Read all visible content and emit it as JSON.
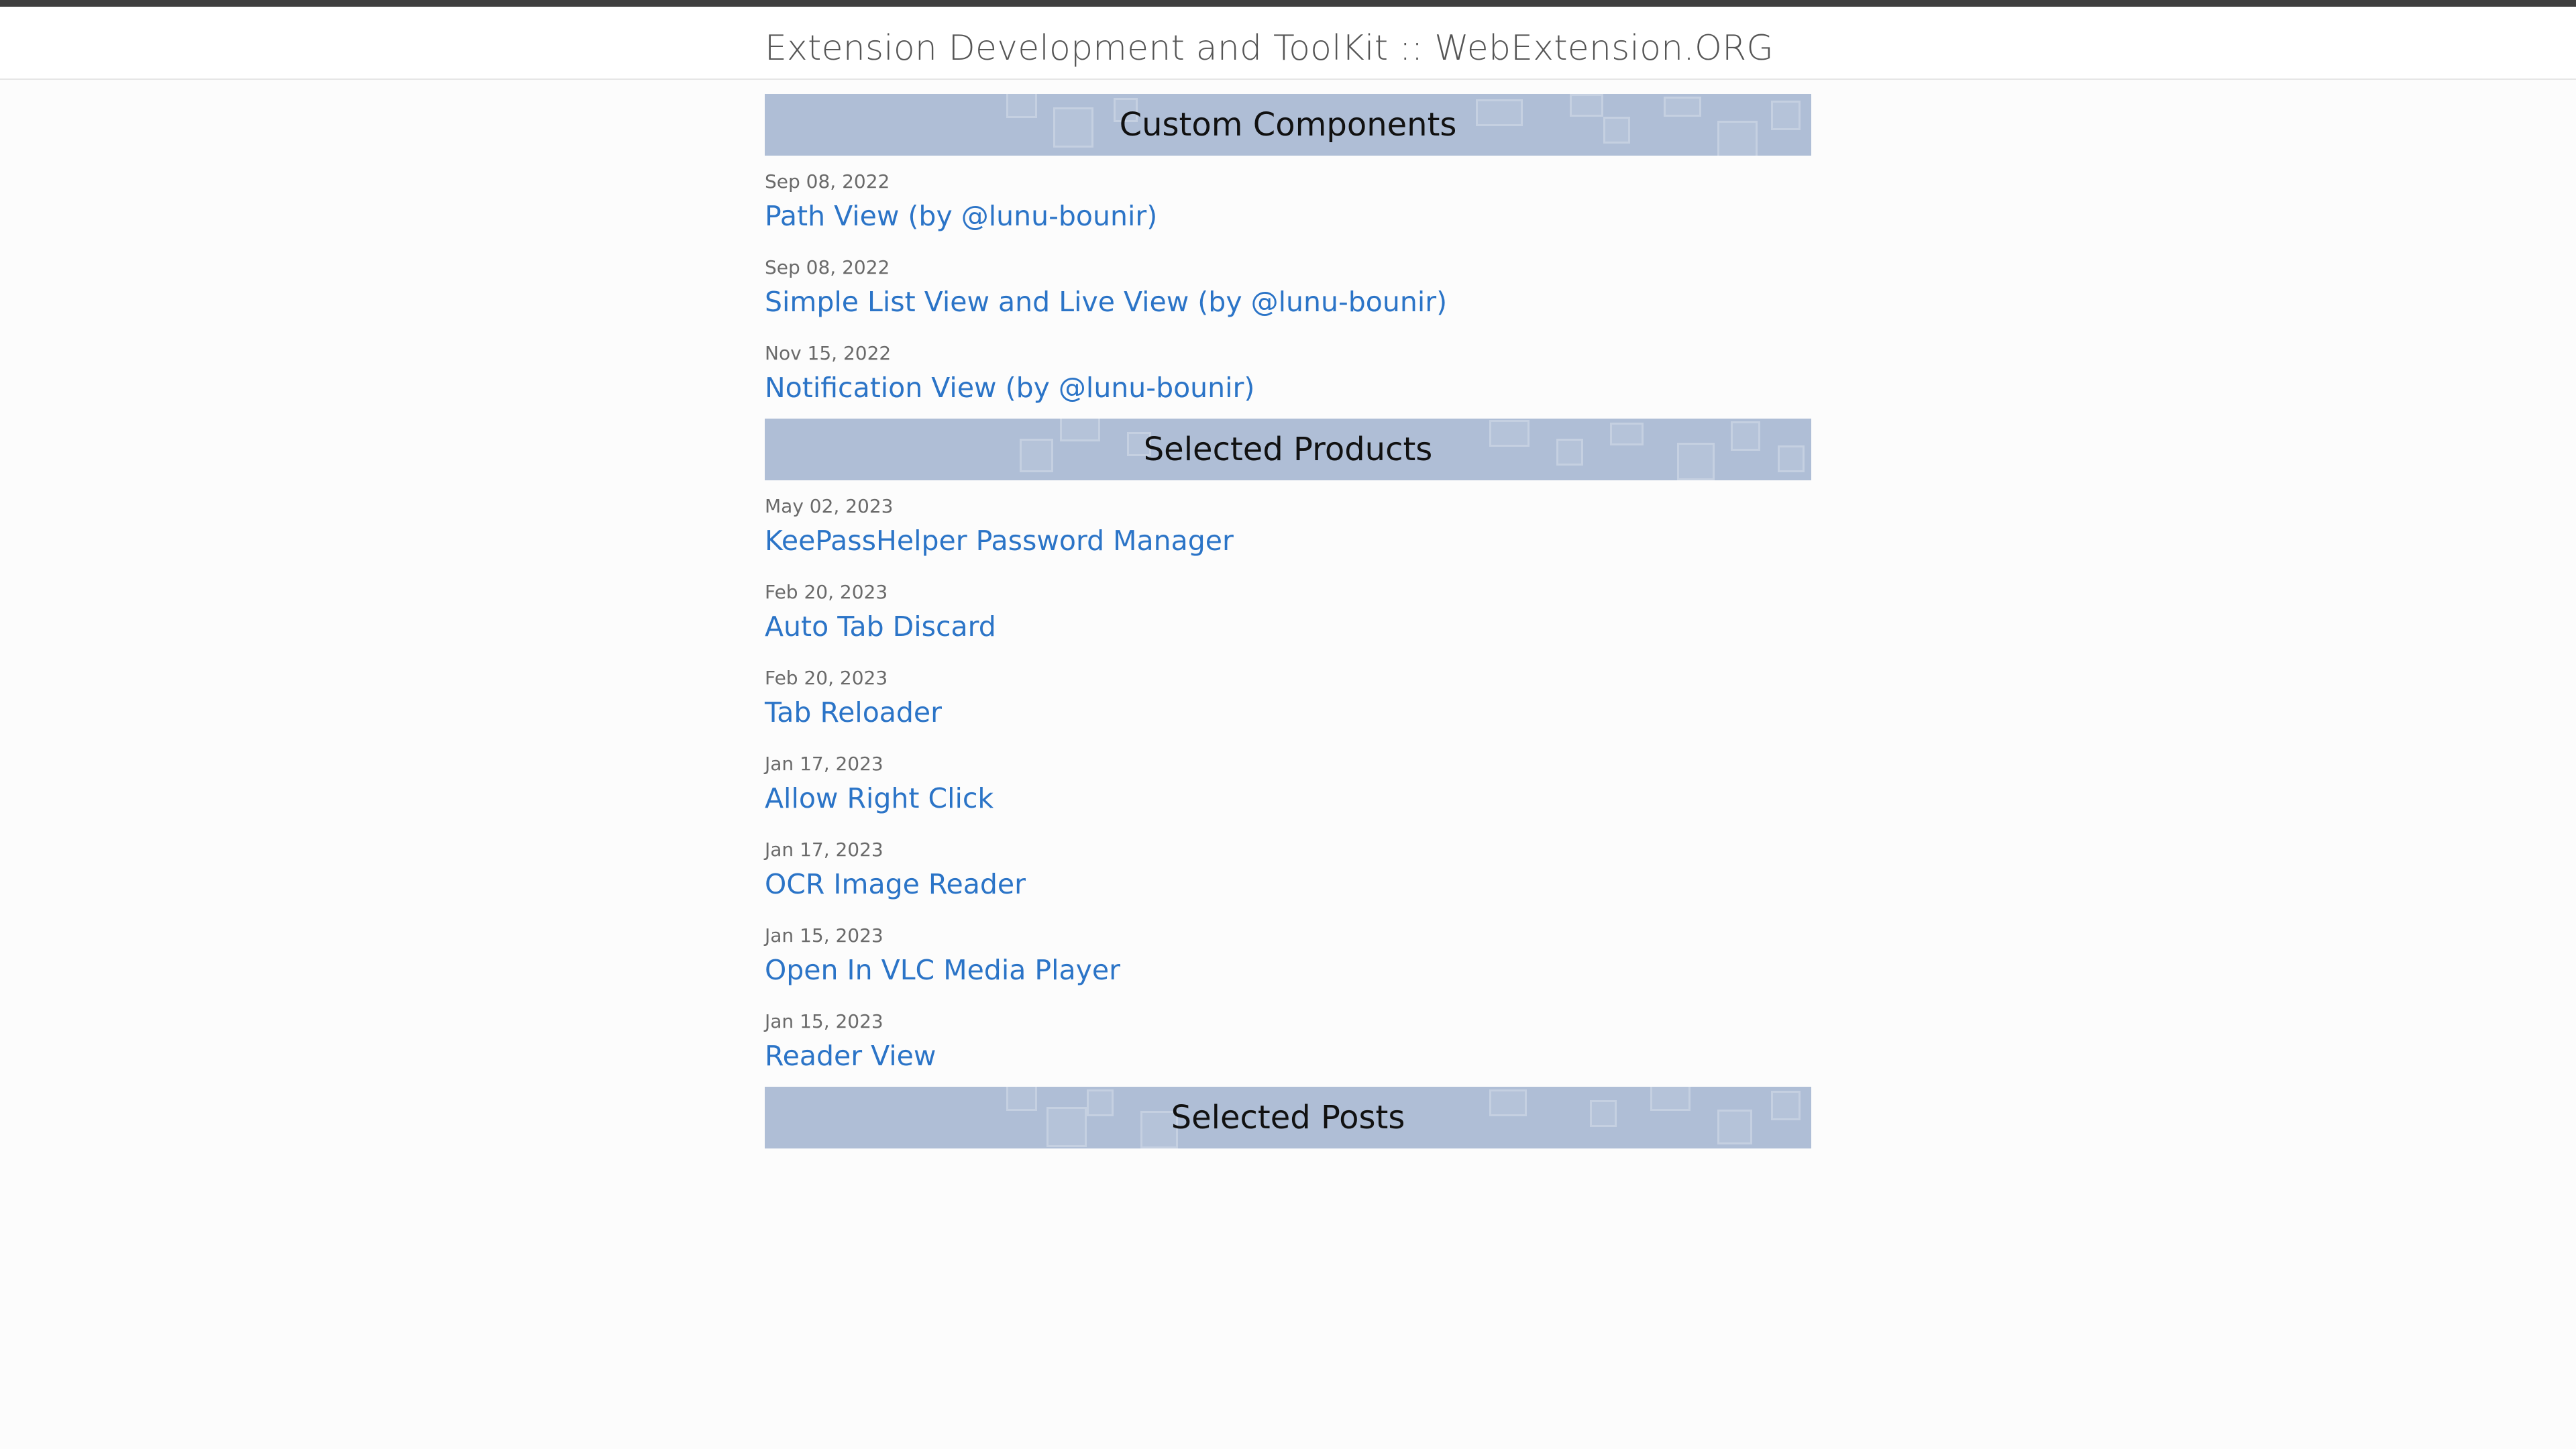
{
  "site": {
    "title": "Extension Development and ToolKit :: WebExtension.ORG"
  },
  "sections": [
    {
      "title": "Custom Components",
      "items": [
        {
          "date": "Sep 08, 2022",
          "title": "Path View (by @lunu-bounir)"
        },
        {
          "date": "Sep 08, 2022",
          "title": "Simple List View and Live View (by @lunu-bounir)"
        },
        {
          "date": "Nov 15, 2022",
          "title": "Notification View (by @lunu-bounir)"
        }
      ]
    },
    {
      "title": "Selected Products",
      "items": [
        {
          "date": "May 02, 2023",
          "title": "KeePassHelper Password Manager"
        },
        {
          "date": "Feb 20, 2023",
          "title": "Auto Tab Discard"
        },
        {
          "date": "Feb 20, 2023",
          "title": "Tab Reloader"
        },
        {
          "date": "Jan 17, 2023",
          "title": "Allow Right Click"
        },
        {
          "date": "Jan 17, 2023",
          "title": "OCR Image Reader"
        },
        {
          "date": "Jan 15, 2023",
          "title": "Open In VLC Media Player"
        },
        {
          "date": "Jan 15, 2023",
          "title": "Reader View"
        }
      ]
    },
    {
      "title": "Selected Posts",
      "items": []
    }
  ],
  "colors": {
    "header_band": "#afbed6",
    "link": "#2b74c7",
    "date": "#6a6a6a",
    "top_bar": "#3f3f3f"
  }
}
